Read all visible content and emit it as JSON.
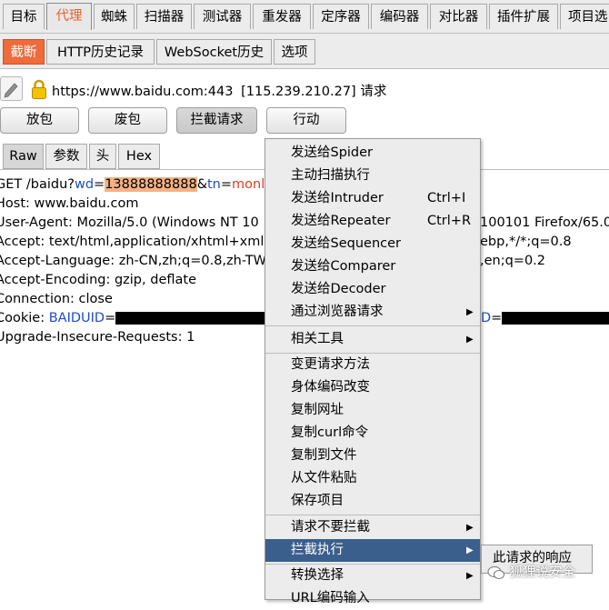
{
  "main_tabs": [
    "目标",
    "代理",
    "蜘蛛",
    "扫描器",
    "测试器",
    "重发器",
    "定序器",
    "编码器",
    "对比器",
    "插件扩展",
    "项目选"
  ],
  "sub_tabs": [
    "截断",
    "HTTP历史记录",
    "WebSocket历史",
    "选项"
  ],
  "request_info": {
    "url": "https://www.baidu.com:443",
    "ip": "[115.239.210.27]",
    "suffix": "请求"
  },
  "buttons": {
    "forward": "放包",
    "drop": "废包",
    "intercept": "拦截请求",
    "action": "行动"
  },
  "editor_tabs": [
    "Raw",
    "参数",
    "头",
    "Hex"
  ],
  "request_lines": {
    "line1": {
      "prefix": "GET /baidu?",
      "param1": "wd",
      "eq1": "=",
      "value1": "13888888888",
      "amp": "&",
      "param2": "tn",
      "eq2": "=",
      "value2": "monl"
    },
    "host": "Host: www.baidu.com",
    "ua_left": "User-Agent: Mozilla/5.0 (Windows NT 10",
    "ua_right": "100101 Firefox/65.0",
    "accept_left": "Accept: text/html,application/xhtml+xml",
    "accept_right": "ebp,*/*;q=0.8",
    "lang_left": "Accept-Language: zh-CN,zh;q=0.8,zh-TW",
    "lang_right": ",en;q=0.2",
    "encoding": "Accept-Encoding: gzip, deflate",
    "connection": "Connection: close",
    "cookie_prefix": "Cookie: ",
    "cookie_name": "BAIDUID",
    "cookie_eq": "=",
    "cookie_right_name": "D",
    "cookie_right_eq": "=",
    "upgrade": "Upgrade-Insecure-Requests: 1"
  },
  "context_menu": {
    "items": [
      {
        "label": "发送给Spider",
        "shortcut": "",
        "submenu": false
      },
      {
        "label": "主动扫描执行",
        "shortcut": "",
        "submenu": false
      },
      {
        "label": "发送给Intruder",
        "shortcut": "Ctrl+I",
        "submenu": false
      },
      {
        "label": "发送给Repeater",
        "shortcut": "Ctrl+R",
        "submenu": false
      },
      {
        "label": "发送给Sequencer",
        "shortcut": "",
        "submenu": false
      },
      {
        "label": "发送给Comparer",
        "shortcut": "",
        "submenu": false
      },
      {
        "label": "发送给Decoder",
        "shortcut": "",
        "submenu": false
      },
      {
        "label": "通过浏览器请求",
        "shortcut": "",
        "submenu": true
      },
      {
        "label": "相关工具",
        "shortcut": "",
        "submenu": true
      },
      {
        "label": "变更请求方法",
        "shortcut": "",
        "submenu": false
      },
      {
        "label": "身体编码改变",
        "shortcut": "",
        "submenu": false
      },
      {
        "label": "复制网址",
        "shortcut": "",
        "submenu": false
      },
      {
        "label": "复制curl命令",
        "shortcut": "",
        "submenu": false
      },
      {
        "label": "复制到文件",
        "shortcut": "",
        "submenu": false
      },
      {
        "label": "从文件粘贴",
        "shortcut": "",
        "submenu": false
      },
      {
        "label": "保存项目",
        "shortcut": "",
        "submenu": false
      },
      {
        "label": "请求不要拦截",
        "shortcut": "",
        "submenu": true
      },
      {
        "label": "拦截执行",
        "shortcut": "",
        "submenu": true
      },
      {
        "label": "转换选择",
        "shortcut": "",
        "submenu": true
      },
      {
        "label": "URL编码输入",
        "shortcut": "",
        "submenu": false
      }
    ],
    "active_index": 17
  },
  "submenu": {
    "item": "此请求的响应"
  },
  "watermark": "狐狸说安全",
  "colors": {
    "active_tab": "#e8612c",
    "intercept_tab": "#ef6b3b",
    "menu_highlight": "#3a5f8c",
    "param_blue": "#1e4bd0",
    "value_red": "#e03a1e",
    "highlight": "#f4b183"
  },
  "icons": {
    "edit": "pencil-icon",
    "secure": "lock-icon",
    "submenu": "triangle-right-icon",
    "watermark": "wechat-icon"
  }
}
